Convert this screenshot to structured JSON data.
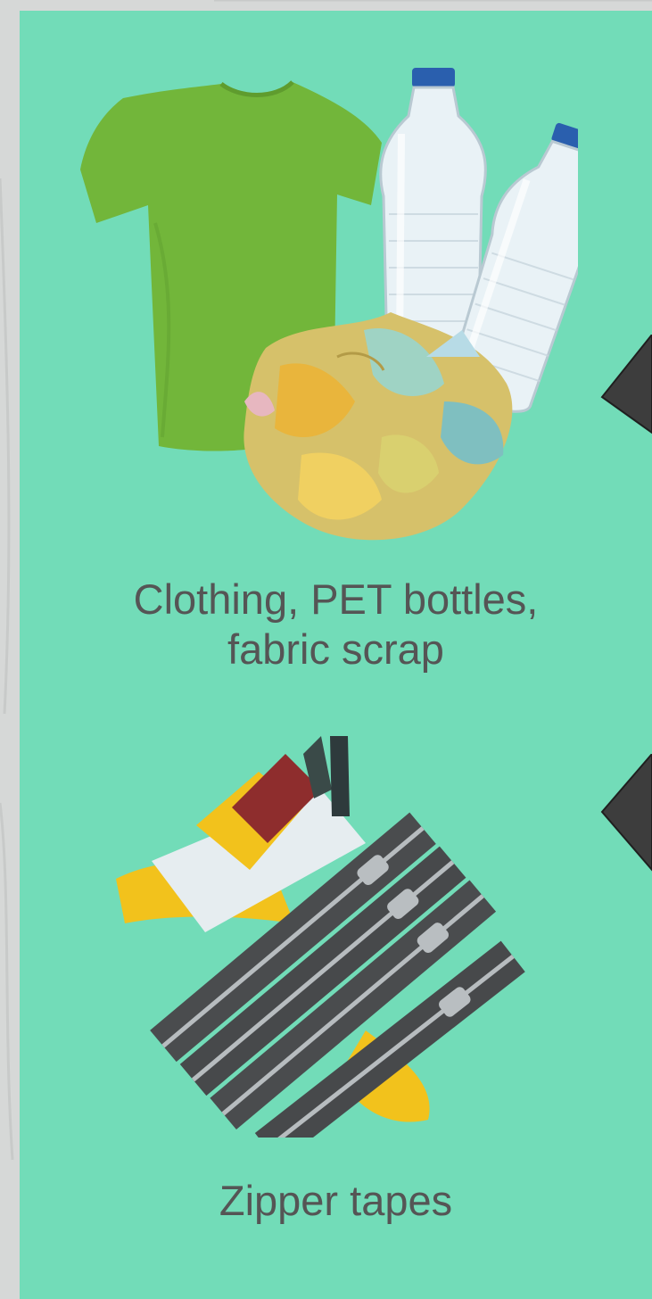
{
  "items": [
    {
      "caption": "Clothing, PET bottles,\nfabric scrap"
    },
    {
      "caption": "Zipper tapes"
    }
  ],
  "colors": {
    "panel": "#72dcb8",
    "caption_text": "#555555",
    "arrow": "#3d3d3d",
    "tshirt": "#72b63a",
    "zipper_tape": "#4a4c4e",
    "zipper_yellow": "#f2c21c"
  },
  "icons": [
    "t-shirt-image",
    "pet-bottles-image",
    "fabric-scrap-image",
    "zipper-tapes-image",
    "chevron-left-icon"
  ]
}
